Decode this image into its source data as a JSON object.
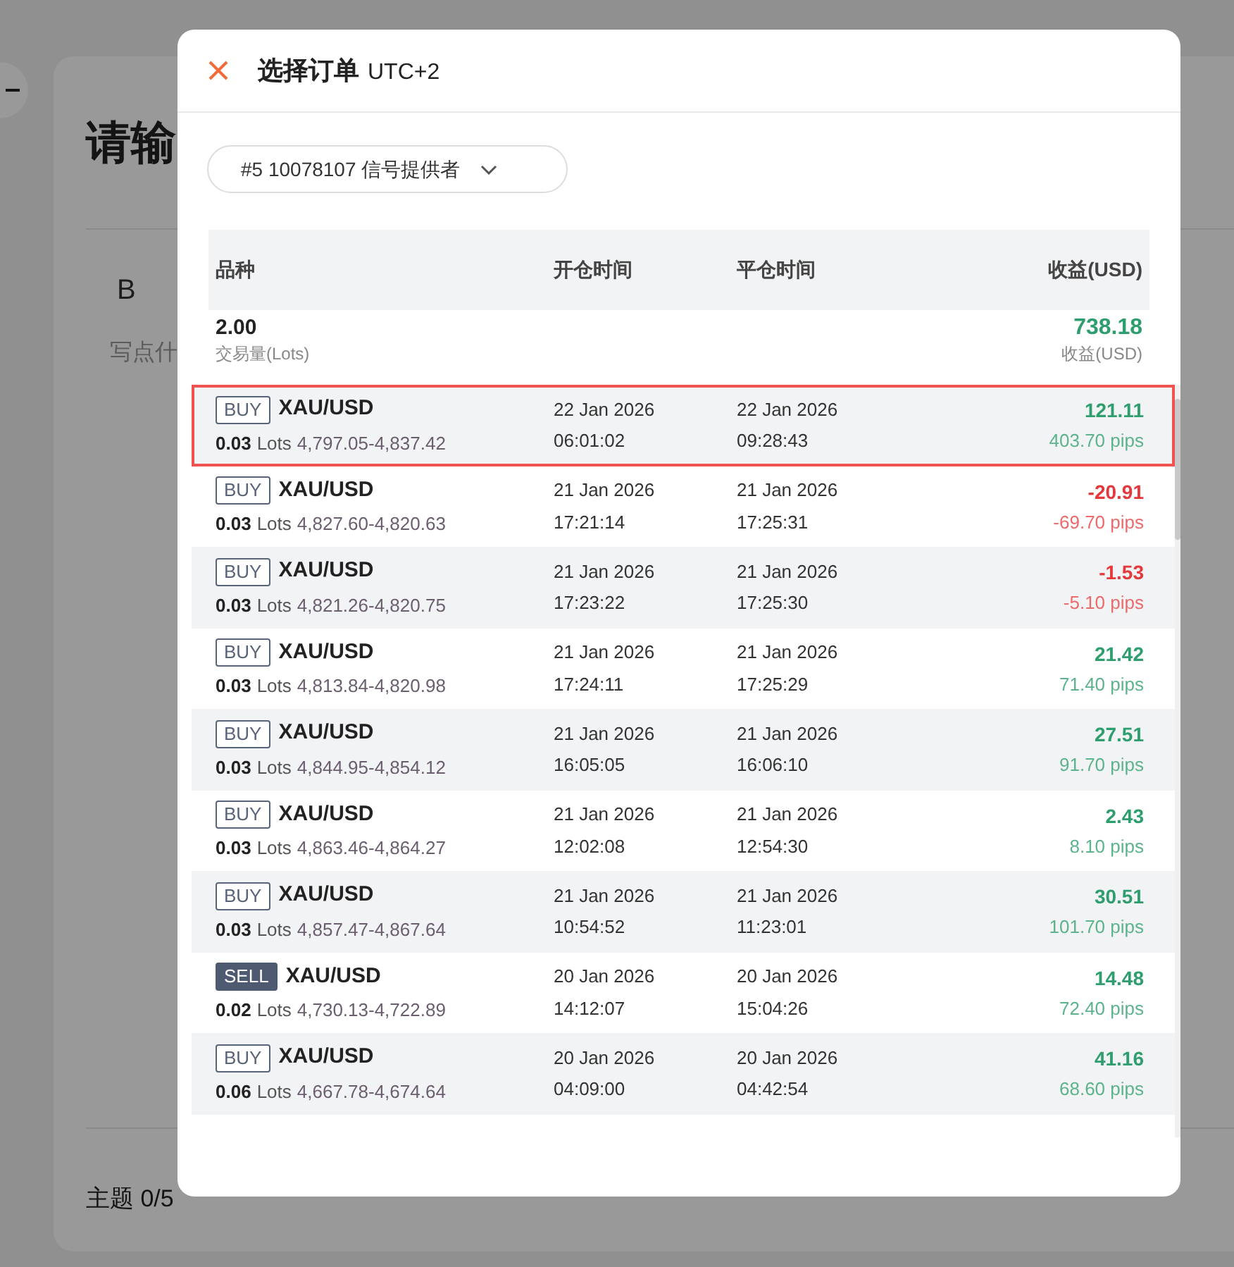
{
  "background": {
    "title": "请输",
    "toolbar": [
      "B"
    ],
    "placeholder": "写点什",
    "topic_label": "主题 0/5"
  },
  "dialog": {
    "title": "选择订单",
    "timezone": "UTC+2",
    "account": "#5 10078107 信号提供者",
    "columns": [
      "品种",
      "开仓时间",
      "平仓时间",
      "收益(USD)"
    ],
    "summary": {
      "volume": "2.00",
      "volume_label": "交易量(Lots)",
      "profit": "738.18",
      "profit_label": "收益(USD)"
    },
    "rows": [
      {
        "side": "BUY",
        "kind": "buy",
        "symbol": "XAU/USD",
        "lots": "0.03",
        "lots_unit": "Lots",
        "prices": "4,797.05-4,837.42",
        "open_date": "22 Jan 2026",
        "open_time": "06:01:02",
        "close_date": "22 Jan 2026",
        "close_time": "09:28:43",
        "profit": "121.11",
        "pips": "403.70 pips",
        "loss": false,
        "selected": true
      },
      {
        "side": "BUY",
        "kind": "buy",
        "symbol": "XAU/USD",
        "lots": "0.03",
        "lots_unit": "Lots",
        "prices": "4,827.60-4,820.63",
        "open_date": "21 Jan 2026",
        "open_time": "17:21:14",
        "close_date": "21 Jan 2026",
        "close_time": "17:25:31",
        "profit": "-20.91",
        "pips": "-69.70 pips",
        "loss": true,
        "selected": false
      },
      {
        "side": "BUY",
        "kind": "buy",
        "symbol": "XAU/USD",
        "lots": "0.03",
        "lots_unit": "Lots",
        "prices": "4,821.26-4,820.75",
        "open_date": "21 Jan 2026",
        "open_time": "17:23:22",
        "close_date": "21 Jan 2026",
        "close_time": "17:25:30",
        "profit": "-1.53",
        "pips": "-5.10 pips",
        "loss": true,
        "selected": false
      },
      {
        "side": "BUY",
        "kind": "buy",
        "symbol": "XAU/USD",
        "lots": "0.03",
        "lots_unit": "Lots",
        "prices": "4,813.84-4,820.98",
        "open_date": "21 Jan 2026",
        "open_time": "17:24:11",
        "close_date": "21 Jan 2026",
        "close_time": "17:25:29",
        "profit": "21.42",
        "pips": "71.40 pips",
        "loss": false,
        "selected": false
      },
      {
        "side": "BUY",
        "kind": "buy",
        "symbol": "XAU/USD",
        "lots": "0.03",
        "lots_unit": "Lots",
        "prices": "4,844.95-4,854.12",
        "open_date": "21 Jan 2026",
        "open_time": "16:05:05",
        "close_date": "21 Jan 2026",
        "close_time": "16:06:10",
        "profit": "27.51",
        "pips": "91.70 pips",
        "loss": false,
        "selected": false
      },
      {
        "side": "BUY",
        "kind": "buy",
        "symbol": "XAU/USD",
        "lots": "0.03",
        "lots_unit": "Lots",
        "prices": "4,863.46-4,864.27",
        "open_date": "21 Jan 2026",
        "open_time": "12:02:08",
        "close_date": "21 Jan 2026",
        "close_time": "12:54:30",
        "profit": "2.43",
        "pips": "8.10 pips",
        "loss": false,
        "selected": false
      },
      {
        "side": "BUY",
        "kind": "buy",
        "symbol": "XAU/USD",
        "lots": "0.03",
        "lots_unit": "Lots",
        "prices": "4,857.47-4,867.64",
        "open_date": "21 Jan 2026",
        "open_time": "10:54:52",
        "close_date": "21 Jan 2026",
        "close_time": "11:23:01",
        "profit": "30.51",
        "pips": "101.70 pips",
        "loss": false,
        "selected": false
      },
      {
        "side": "SELL",
        "kind": "sell",
        "symbol": "XAU/USD",
        "lots": "0.02",
        "lots_unit": "Lots",
        "prices": "4,730.13-4,722.89",
        "open_date": "20 Jan 2026",
        "open_time": "14:12:07",
        "close_date": "20 Jan 2026",
        "close_time": "15:04:26",
        "profit": "14.48",
        "pips": "72.40 pips",
        "loss": false,
        "selected": false
      },
      {
        "side": "BUY",
        "kind": "buy",
        "symbol": "XAU/USD",
        "lots": "0.06",
        "lots_unit": "Lots",
        "prices": "4,667.78-4,674.64",
        "open_date": "20 Jan 2026",
        "open_time": "04:09:00",
        "close_date": "20 Jan 2026",
        "close_time": "04:42:54",
        "profit": "41.16",
        "pips": "68.60 pips",
        "loss": false,
        "selected": false
      }
    ]
  }
}
